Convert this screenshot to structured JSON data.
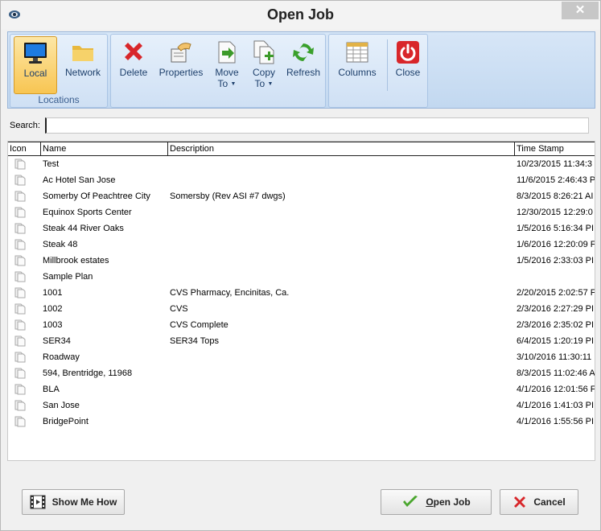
{
  "window": {
    "title": "Open Job",
    "close_glyph": "✕"
  },
  "ribbon": {
    "locations": {
      "label": "Locations",
      "items": [
        {
          "label": "Local",
          "icon": "monitor-icon",
          "active": true
        },
        {
          "label": "Network",
          "icon": "folder-icon",
          "active": false
        }
      ]
    },
    "actions": {
      "items": [
        {
          "label": "Delete",
          "icon": "delete-x-icon"
        },
        {
          "label": "Properties",
          "icon": "properties-hand-icon"
        },
        {
          "label": "Move",
          "label2": "To",
          "icon": "move-to-icon",
          "dropdown": true
        },
        {
          "label": "Copy",
          "label2": "To",
          "icon": "copy-to-icon",
          "dropdown": true
        },
        {
          "label": "Refresh",
          "icon": "refresh-icon"
        }
      ]
    },
    "view": {
      "items": [
        {
          "label": "Columns",
          "icon": "columns-icon"
        },
        {
          "label": "Close",
          "icon": "power-icon"
        }
      ]
    },
    "caret": "▼"
  },
  "search": {
    "label": "Search:",
    "value": "",
    "placeholder": ""
  },
  "table": {
    "columns": [
      "Icon",
      "Name",
      "Description",
      "Time Stamp"
    ],
    "rows": [
      {
        "name": "Test",
        "description": "",
        "timestamp": "10/23/2015 11:34:3"
      },
      {
        "name": "Ac Hotel San Jose",
        "description": "",
        "timestamp": "11/6/2015 2:46:43 P"
      },
      {
        "name": "Somerby Of Peachtree City",
        "description": "Somersby (Rev ASI #7 dwgs)",
        "timestamp": "8/3/2015 8:26:21 AI"
      },
      {
        "name": "Equinox Sports Center",
        "description": "",
        "timestamp": "12/30/2015 12:29:0"
      },
      {
        "name": "Steak 44 River Oaks",
        "description": "",
        "timestamp": "1/5/2016 5:16:34 PI"
      },
      {
        "name": "Steak 48",
        "description": "",
        "timestamp": "1/6/2016 12:20:09 F"
      },
      {
        "name": "Millbrook estates",
        "description": "",
        "timestamp": "1/5/2016 2:33:03 PI"
      },
      {
        "name": "Sample Plan",
        "description": "",
        "timestamp": ""
      },
      {
        "name": "1001",
        "description": "CVS Pharmacy, Encinitas, Ca.",
        "timestamp": "2/20/2015 2:02:57 F"
      },
      {
        "name": "1002",
        "description": "CVS",
        "timestamp": "2/3/2016 2:27:29 PI"
      },
      {
        "name": "1003",
        "description": "CVS Complete",
        "timestamp": "2/3/2016 2:35:02 PI"
      },
      {
        "name": "SER34",
        "description": "SER34 Tops",
        "timestamp": "6/4/2015 1:20:19 PI"
      },
      {
        "name": "Roadway",
        "description": "",
        "timestamp": "3/10/2016 11:30:11"
      },
      {
        "name": "594, Brentridge, 11968",
        "description": "",
        "timestamp": "8/3/2015 11:02:46 A"
      },
      {
        "name": "BLA",
        "description": "",
        "timestamp": "4/1/2016 12:01:56 F"
      },
      {
        "name": "San Jose",
        "description": "",
        "timestamp": "4/1/2016 1:41:03 PI"
      },
      {
        "name": "BridgePoint",
        "description": "",
        "timestamp": "4/1/2016 1:55:56 PI"
      }
    ]
  },
  "footer": {
    "show_me_how": "Show Me How",
    "open_job": "Open Job",
    "cancel": "Cancel"
  },
  "colors": {
    "ribbon_bg": "#c9dcf2",
    "active_button": "#f8c552",
    "delete_red": "#d8262a",
    "open_check_green": "#4aa62e"
  }
}
